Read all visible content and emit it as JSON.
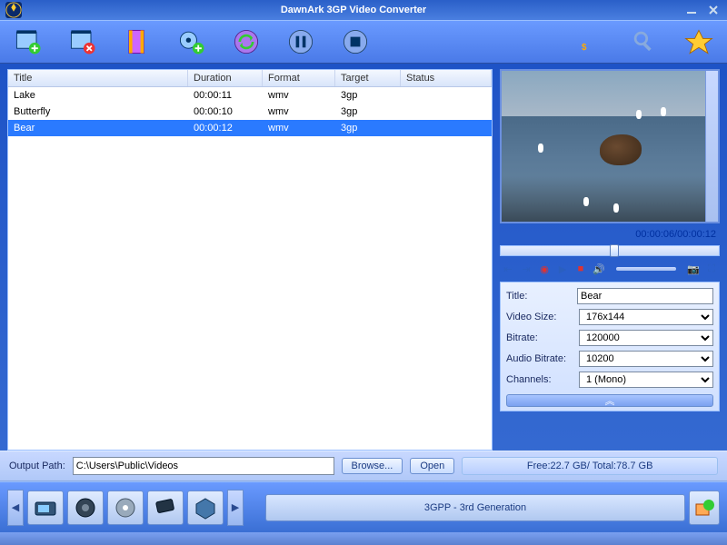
{
  "app": {
    "title": "DawnArk 3GP Video Converter"
  },
  "columns": {
    "title": "Title",
    "duration": "Duration",
    "format": "Format",
    "target": "Target",
    "status": "Status"
  },
  "files": [
    {
      "title": "Lake",
      "duration": "00:00:11",
      "format": "wmv",
      "target": "3gp",
      "status": ""
    },
    {
      "title": "Butterfly",
      "duration": "00:00:10",
      "format": "wmv",
      "target": "3gp",
      "status": ""
    },
    {
      "title": "Bear",
      "duration": "00:00:12",
      "format": "wmv",
      "target": "3gp",
      "status": ""
    }
  ],
  "selected_index": 2,
  "preview": {
    "time": "00:00:06/00:00:12",
    "seek_percent": 50
  },
  "props": {
    "title_label": "Title:",
    "title_value": "Bear",
    "videosize_label": "Video Size:",
    "videosize_value": "176x144",
    "bitrate_label": "Bitrate:",
    "bitrate_value": "120000",
    "audiobitrate_label": "Audio Bitrate:",
    "audiobitrate_value": "10200",
    "channels_label": "Channels:",
    "channels_value": "1 (Mono)"
  },
  "output": {
    "label": "Output Path:",
    "path": "C:\\Users\\Public\\Videos",
    "browse": "Browse...",
    "open": "Open",
    "disk": "Free:22.7 GB/ Total:78.7 GB"
  },
  "profile": {
    "label": "3GPP - 3rd Generation"
  }
}
